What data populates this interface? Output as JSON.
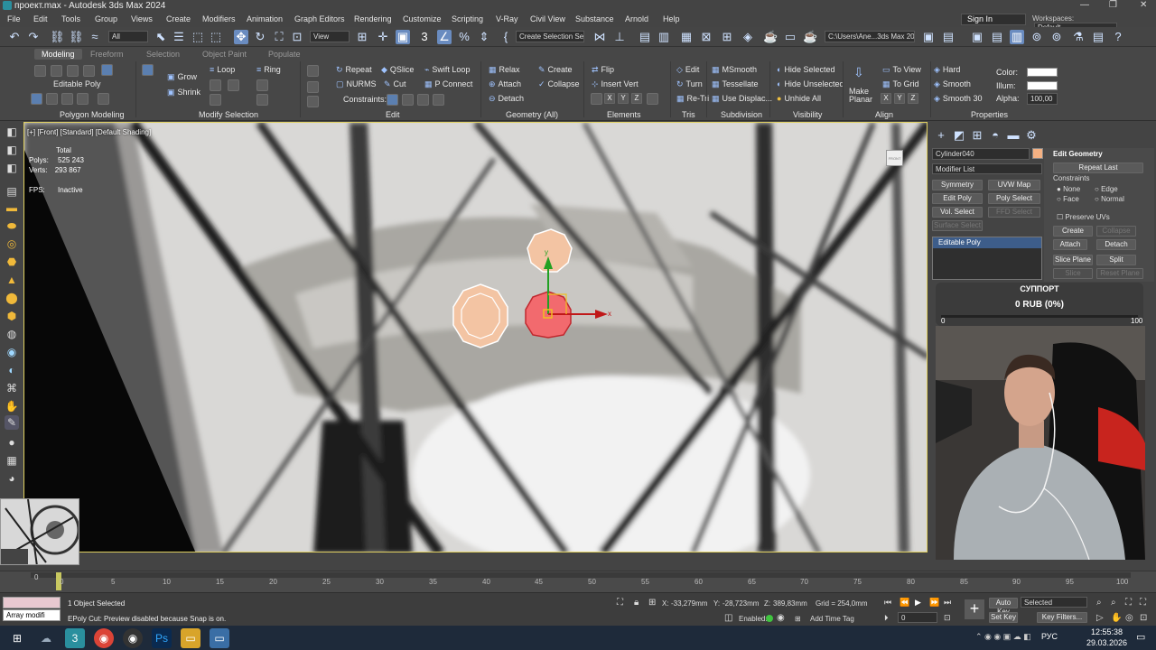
{
  "window": {
    "title": "проект.max - Autodesk 3ds Max 2024",
    "minimize": "—",
    "maximize": "❐",
    "close": "✕"
  },
  "menus": [
    "File",
    "Edit",
    "Tools",
    "Group",
    "Views",
    "Create",
    "Modifiers",
    "Animation",
    "Graph Editors",
    "Rendering",
    "Customize",
    "Scripting",
    "V-Ray",
    "Civil View",
    "Substance",
    "Arnold",
    "Help"
  ],
  "account": {
    "sign_in": "Sign In",
    "workspaces_label": "Workspaces:",
    "workspace": "Default"
  },
  "toolbar": {
    "filter": "All",
    "ref_coord": "View",
    "named_selection": "Create Selection Se",
    "path": "C:\\Users\\Ane...3ds Max 2024"
  },
  "ribbon": {
    "tabs": [
      "Modeling",
      "Freeform",
      "Selection",
      "Object Paint",
      "Populate"
    ],
    "editable_poly": "Editable Poly",
    "grow": "Grow",
    "shrink": "Shrink",
    "loop": "Loop",
    "ring": "Ring",
    "repeat": "Repeat",
    "qslice": "QSlice",
    "swift_loop": "Swift Loop",
    "nurms": "NURMS",
    "cut": "Cut",
    "p_connect": "P Connect",
    "constraints": "Constraints:",
    "relax": "Relax",
    "create": "Create",
    "attach": "Attach",
    "collapse": "Collapse",
    "detach": "Detach",
    "flip": "Flip",
    "insert_vert": "Insert Vert",
    "edit": "Edit",
    "turn": "Turn",
    "retri": "Re-Tri",
    "msmooth": "MSmooth",
    "tessellate": "Tessellate",
    "use_displac": "Use Displac...",
    "hide_selected": "Hide Selected",
    "hide_unselected": "Hide Unselected",
    "unhide_all": "Unhide All",
    "make_planar": "Make Planar",
    "to_view": "To View",
    "to_grid": "To Grid",
    "x": "X",
    "y": "Y",
    "z": "Z",
    "hard": "Hard",
    "smooth": "Smooth",
    "smooth30": "Smooth 30",
    "color_label": "Color:",
    "illum_label": "Illum:",
    "alpha_label": "Alpha:",
    "alpha": "100,00",
    "groups": [
      "Polygon Modeling",
      "Modify Selection",
      "Edit",
      "Geometry (All)",
      "Elements",
      "Tris",
      "Subdivision",
      "Visibility",
      "Align",
      "Properties"
    ]
  },
  "viewport": {
    "label": "[+] [Front] [Standard] [Default Shading]",
    "total": "Total",
    "polys_label": "Polys:",
    "polys": "525 243",
    "verts_label": "Verts:",
    "verts": "293 867",
    "fps_label": "FPS:",
    "fps": "Inactive",
    "cube": "FRONT",
    "gizmo_x": "x",
    "gizmo_y": "y"
  },
  "command_panel": {
    "object_name": "Cylinder040",
    "object_color": "#f4b183",
    "modifier_list": "Modifier List",
    "buttons": [
      "Symmetry",
      "UVW Map",
      "Edit Poly",
      "Poly Select",
      "Vol. Select",
      "FFD Select",
      "Surface Select"
    ],
    "stack_item": "Editable Poly",
    "rollout_title": "Edit Geometry",
    "repeat_last": "Repeat Last",
    "constraints": "Constraints",
    "none": "None",
    "edge": "Edge",
    "face": "Face",
    "normal": "Normal",
    "preserve_uvs": "Preserve UVs",
    "create": "Create",
    "collapse": "Collapse",
    "attach": "Attach",
    "detach": "Detach",
    "slice_plane": "Slice Plane",
    "split": "Split",
    "slice": "Slice",
    "reset_plane": "Reset Plane"
  },
  "support": {
    "title": "СУППОРТ",
    "amount": "0 RUB (0%)",
    "min": "0",
    "max": "100",
    "progress": 0
  },
  "timeline": {
    "frame": "0 / 100",
    "ticks": [
      "0",
      "5",
      "10",
      "15",
      "20",
      "25",
      "30",
      "35",
      "40",
      "45",
      "50",
      "55",
      "60",
      "65",
      "70",
      "75",
      "80",
      "85",
      "90",
      "95",
      "100"
    ]
  },
  "status": {
    "script_listener": "Array modifi",
    "selected": "1 Object Selected",
    "prompt": "EPoly Cut: Preview disabled because Snap is on.",
    "x_label": "X:",
    "x": "-33,279mm",
    "y_label": "Y:",
    "y": "-28,723mm",
    "z_label": "Z:",
    "z": "389,83mm",
    "grid": "Grid = 254,0mm",
    "enabled": "Enabled:",
    "add_time_tag": "Add Time Tag",
    "auto_key": "Auto Key",
    "set_key": "Set Key",
    "key_mode": "Selected",
    "key_filters": "Key Filters...",
    "frame": "0"
  },
  "taskbar": {
    "lang": "РУС",
    "time": "12:55:38",
    "date": "29.03.2026"
  }
}
